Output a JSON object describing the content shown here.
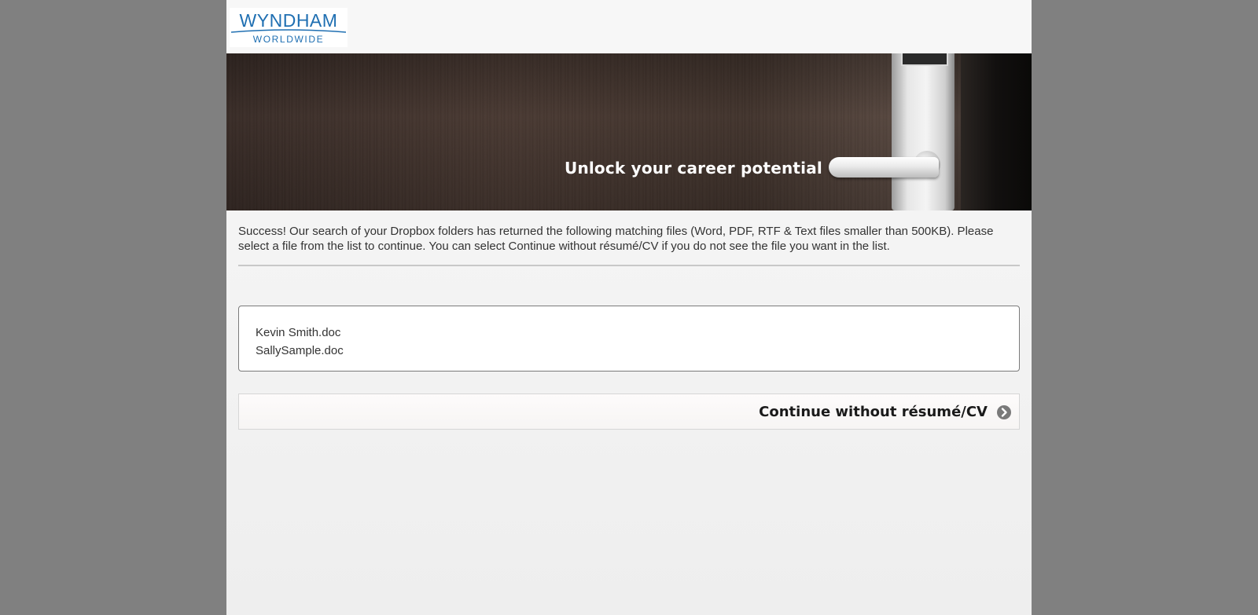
{
  "header": {
    "logo_main": "WYNDHAM",
    "logo_sub": "WORLDWIDE"
  },
  "banner": {
    "tagline": "Unlock your career potential"
  },
  "main": {
    "intro": "Success! Our search of your Dropbox folders has returned the following matching files (Word, PDF, RTF & Text files smaller than 500KB). Please select a file from the list to continue. You can select Continue without résumé/CV if you do not see the file you want in the list.",
    "files": [
      {
        "name": "Kevin Smith.doc"
      },
      {
        "name": "SallySample.doc"
      }
    ],
    "continue_label": "Continue without résumé/CV"
  },
  "icons": {
    "continue": "chevron-right-circle-icon"
  },
  "colors": {
    "brand_blue": "#1f6fb2",
    "backdrop": "#808080"
  }
}
